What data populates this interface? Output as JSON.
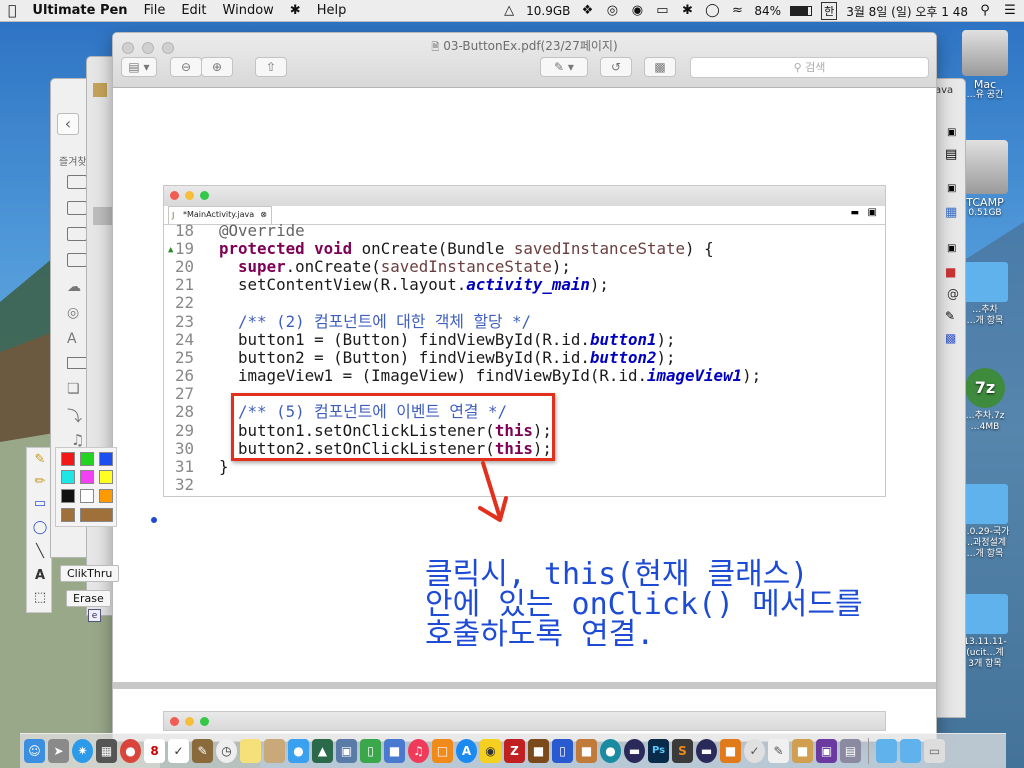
{
  "menubar": {
    "apple": "",
    "app": "Ultimate Pen",
    "items": [
      "File",
      "Edit",
      "Window",
      "Help"
    ],
    "memory": "10.9GB",
    "battery": "84%",
    "input": "한",
    "clock": "3월 8일 (일) 오후 1 48"
  },
  "viewer": {
    "title": "03-ButtonEx.pdf(23/27페이지)",
    "search_placeholder": "검색"
  },
  "eclipse": {
    "tab_label": "*MainActivity.java",
    "lines": [
      {
        "num": "18",
        "code": "@Override"
      },
      {
        "num": "19",
        "code": "protected void onCreate(Bundle savedInstanceState) {"
      },
      {
        "num": "20",
        "code": "super.onCreate(savedInstanceState);"
      },
      {
        "num": "21",
        "code": "setContentView(R.layout.activity_main);"
      },
      {
        "num": "22",
        "code": ""
      },
      {
        "num": "23",
        "code": "/** (2) 컴포넌트에 대한 객체 할당 */"
      },
      {
        "num": "24",
        "code": "button1 = (Button) findViewById(R.id.button1);"
      },
      {
        "num": "25",
        "code": "button2 = (Button) findViewById(R.id.button2);"
      },
      {
        "num": "26",
        "code": "imageView1 = (ImageView) findViewById(R.id.imageView1);"
      },
      {
        "num": "27",
        "code": ""
      },
      {
        "num": "28",
        "code": "/** (5) 컴포넌트에 이벤트 연결 */"
      },
      {
        "num": "29",
        "code": "button1.setOnClickListener(this);"
      },
      {
        "num": "30",
        "code": "button2.setOnClickListener(this);"
      },
      {
        "num": "31",
        "code": "}"
      },
      {
        "num": "32",
        "code": ""
      }
    ]
  },
  "annotation": {
    "line1": "클릭시, this(현재 클래스)",
    "line2": "안에 있는 onClick() 메서드를",
    "line3": "호출하도록 연결."
  },
  "pen_palette": {
    "tooltip_clickthru": "ClikThru",
    "tooltip_erase": "Erase",
    "colors": [
      "#f21818",
      "#22d422",
      "#1c4ff0",
      "#1ee6e6",
      "#f240f2",
      "#ffff22",
      "#111111",
      "#ffffff",
      "#ff9a00",
      "#a0703a",
      "#a0703a"
    ]
  },
  "sidebar": {
    "label": "즐겨찾"
  },
  "desktop_icons": [
    {
      "name": "Mac",
      "sub": "…유 공간"
    },
    {
      "name": "TCAMP",
      "sub": "0.51GB"
    },
    {
      "name": "…추차",
      "sub": "…개 항목"
    },
    {
      "name": "…추차.7z",
      "sub": "…4MB"
    },
    {
      "name": "…0.29-국가",
      "sub": "…과정설계"
    },
    {
      "name": "…개 항목",
      "sub": ""
    },
    {
      "name": "13.11.11-",
      "sub": "(ucit…계"
    },
    {
      "name": "3개 항목",
      "sub": ""
    }
  ],
  "colors": {
    "annotation_blue": "#1d4bd6",
    "highlight_red": "#e3301c",
    "keyword": "#7f0055",
    "field": "#0000c0",
    "comment": "#3f5fbf"
  }
}
